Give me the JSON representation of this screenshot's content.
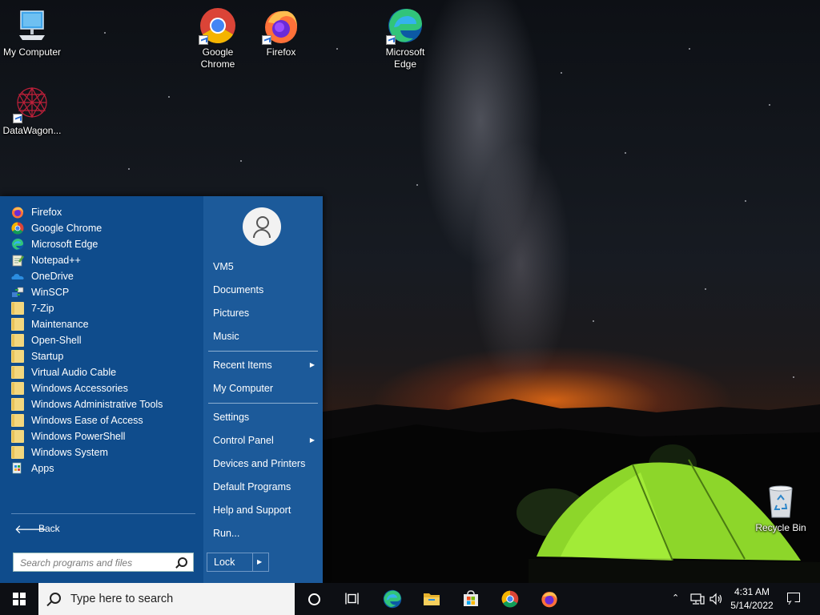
{
  "desktop": {
    "icons": [
      {
        "label": "My Computer",
        "icon": "computer-icon"
      },
      {
        "label": "Google\nChrome",
        "icon": "chrome-icon"
      },
      {
        "label": "Firefox",
        "icon": "firefox-icon"
      },
      {
        "label": "Microsoft\nEdge",
        "icon": "edge-icon"
      },
      {
        "label": "DataWagon...",
        "icon": "datawagon-icon"
      },
      {
        "label": "Recycle Bin",
        "icon": "recycle-bin-icon"
      }
    ]
  },
  "start_menu": {
    "programs": [
      {
        "label": "Firefox",
        "icon": "firefox-icon"
      },
      {
        "label": "Google Chrome",
        "icon": "chrome-icon"
      },
      {
        "label": "Microsoft Edge",
        "icon": "edge-icon"
      },
      {
        "label": "Notepad++",
        "icon": "notepadpp-icon"
      },
      {
        "label": "OneDrive",
        "icon": "onedrive-icon"
      },
      {
        "label": "WinSCP",
        "icon": "winscp-icon"
      },
      {
        "label": "7-Zip",
        "icon": "folder-icon"
      },
      {
        "label": "Maintenance",
        "icon": "folder-icon"
      },
      {
        "label": "Open-Shell",
        "icon": "folder-icon"
      },
      {
        "label": "Startup",
        "icon": "folder-icon"
      },
      {
        "label": "Virtual Audio Cable",
        "icon": "folder-icon"
      },
      {
        "label": "Windows Accessories",
        "icon": "folder-icon"
      },
      {
        "label": "Windows Administrative Tools",
        "icon": "folder-icon"
      },
      {
        "label": "Windows Ease of Access",
        "icon": "folder-icon"
      },
      {
        "label": "Windows PowerShell",
        "icon": "folder-icon"
      },
      {
        "label": "Windows System",
        "icon": "folder-icon"
      },
      {
        "label": "Apps",
        "icon": "apps-icon"
      }
    ],
    "back_label": "Back",
    "search_placeholder": "Search programs and files",
    "right": {
      "user": "VM5",
      "items": [
        {
          "label": "Documents"
        },
        {
          "label": "Pictures"
        },
        {
          "label": "Music"
        },
        {
          "label": "Recent Items",
          "submenu": true
        },
        {
          "label": "My Computer"
        },
        {
          "label": "Settings"
        },
        {
          "label": "Control Panel",
          "submenu": true
        },
        {
          "label": "Devices and Printers"
        },
        {
          "label": "Default Programs"
        },
        {
          "label": "Help and Support"
        },
        {
          "label": "Run..."
        }
      ],
      "lock_label": "Lock"
    }
  },
  "taskbar": {
    "search_placeholder": "Type here to search",
    "pinned": [
      "edge-icon",
      "file-explorer-icon",
      "store-icon",
      "chrome-icon",
      "firefox-icon"
    ],
    "tray": {
      "time": "4:31 AM",
      "date": "5/14/2022"
    }
  }
}
